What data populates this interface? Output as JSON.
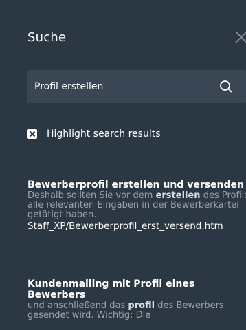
{
  "panel": {
    "title": "Suche",
    "close_icon": "close-icon"
  },
  "search": {
    "value": "Profil erstellen",
    "icon": "search-icon"
  },
  "highlight": {
    "checked": true,
    "label": "Highlight search results"
  },
  "results": [
    {
      "title": "Bewerberprofil erstellen und versenden",
      "snippet_before": "Deshalb sollten Sie vor dem ",
      "snippet_bold": "erstellen",
      "snippet_after": " des Profils alle relevanten Eingaben in der Bewerberkartei getätigt haben.",
      "url": "Staff_XP/Bewerberprofil_erst_versend.htm"
    },
    {
      "title": "Kundenmailing mit Profil eines Bewerbers",
      "snippet_before": "und anschließend das ",
      "snippet_bold": "profil",
      "snippet_after": " des Bewerbers gesendet wird. Wichtig: Die"
    }
  ],
  "colors": {
    "background": "#2b3743",
    "search_box": "#3a4653",
    "snippet_text": "#9aa3ad"
  }
}
